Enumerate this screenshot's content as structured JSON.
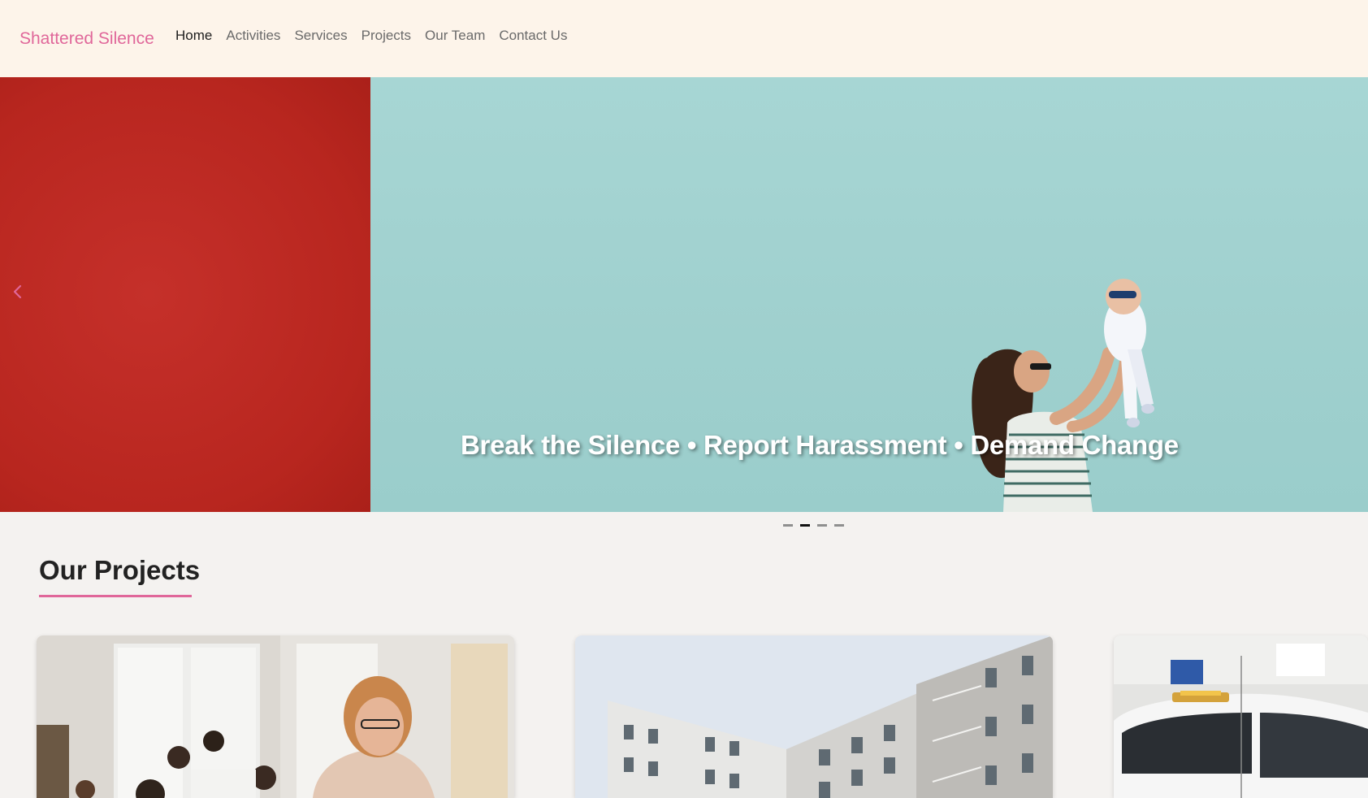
{
  "brand": "Shattered Silence",
  "nav": {
    "items": [
      "Home",
      "Activities",
      "Services",
      "Projects",
      "Our Team",
      "Contact Us"
    ],
    "active": "Home"
  },
  "hero": {
    "caption": "Break the Silence • Report Harassment • Demand Change",
    "slide_count": 4,
    "active_slide": 2,
    "prev_icon": "chevron-left-icon"
  },
  "projects": {
    "title": "Our Projects",
    "cards": [
      {
        "image": "classroom-teacher-photo"
      },
      {
        "image": "apartment-building-photo"
      },
      {
        "image": "police-car-photo"
      }
    ]
  },
  "colors": {
    "brand": "#e0679a",
    "navbar_bg": "#fdf4ea",
    "hero_left": "#b8261f",
    "hero_right": "#9fd0ce",
    "page_bg": "#f4f2f0"
  }
}
